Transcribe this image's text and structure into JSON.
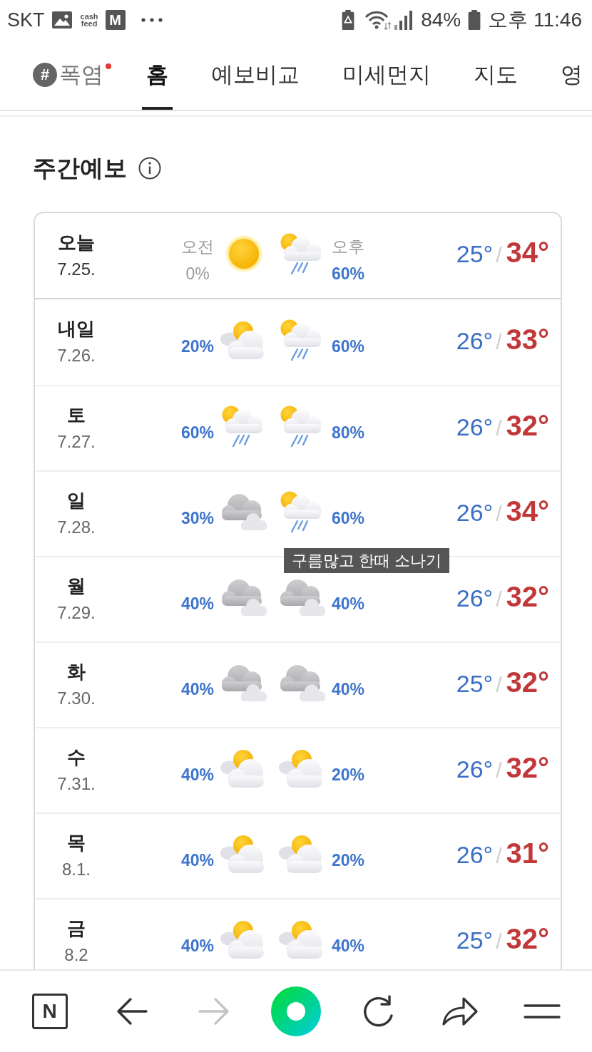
{
  "status_bar": {
    "carrier": "SKT",
    "left_icons": [
      {
        "kind": "image"
      },
      {
        "kind": "text_logo",
        "lines": [
          "cash",
          "feed"
        ]
      },
      {
        "kind": "letter_app",
        "letter": "M"
      },
      {
        "kind": "more"
      }
    ],
    "right_items": [
      {
        "kind": "battery_saver"
      },
      {
        "kind": "wifi"
      },
      {
        "kind": "signal"
      },
      {
        "kind": "battery_percent",
        "text": "84%"
      },
      {
        "kind": "battery"
      },
      {
        "kind": "clock",
        "text": "오후 11:46"
      }
    ]
  },
  "tabs": [
    {
      "hashtag": "#",
      "label": "폭염",
      "new": true,
      "selected": false
    },
    {
      "label": "홈",
      "new": false,
      "selected": true
    },
    {
      "label": "예보비교",
      "new": false,
      "selected": false
    },
    {
      "label": "미세먼지",
      "new": false,
      "selected": false
    },
    {
      "label": "지도",
      "new": false,
      "selected": false
    },
    {
      "label": "영",
      "new": false,
      "selected": false
    }
  ],
  "section": {
    "title": "주간예보"
  },
  "forecast": [
    {
      "day": "오늘",
      "date": "7.25.",
      "today": true,
      "periods": [
        {
          "kind": "sunny",
          "label": "오전",
          "chance": "0%",
          "muted": true
        },
        {
          "kind": "shower",
          "label": "오후",
          "chance": "60%",
          "muted": false
        }
      ],
      "low": "25°",
      "sep": "/",
      "high": "34°"
    },
    {
      "day": "내일",
      "date": "7.26.",
      "today": false,
      "periods": [
        {
          "kind": "partly_cloudy",
          "chance": "20%",
          "muted": false
        },
        {
          "kind": "shower",
          "chance": "60%",
          "muted": false
        }
      ],
      "low": "26°",
      "sep": "/",
      "high": "33°"
    },
    {
      "day": "토",
      "date": "7.27.",
      "today": false,
      "periods": [
        {
          "kind": "shower",
          "chance": "60%",
          "muted": false
        },
        {
          "kind": "shower",
          "chance": "80%",
          "muted": false
        }
      ],
      "low": "26°",
      "sep": "/",
      "high": "32°"
    },
    {
      "day": "일",
      "date": "7.28.",
      "today": false,
      "periods": [
        {
          "kind": "cloudy",
          "chance": "30%",
          "muted": false
        },
        {
          "kind": "shower",
          "chance": "60%",
          "muted": false,
          "tooltip": "구름많고 한때 소나기"
        }
      ],
      "low": "26°",
      "sep": "/",
      "high": "34°"
    },
    {
      "day": "월",
      "date": "7.29.",
      "today": false,
      "periods": [
        {
          "kind": "cloudy",
          "chance": "40%",
          "muted": false
        },
        {
          "kind": "cloudy",
          "chance": "40%",
          "muted": false
        }
      ],
      "low": "26°",
      "sep": "/",
      "high": "32°"
    },
    {
      "day": "화",
      "date": "7.30.",
      "today": false,
      "periods": [
        {
          "kind": "cloudy",
          "chance": "40%",
          "muted": false
        },
        {
          "kind": "cloudy",
          "chance": "40%",
          "muted": false
        }
      ],
      "low": "25°",
      "sep": "/",
      "high": "32°"
    },
    {
      "day": "수",
      "date": "7.31.",
      "today": false,
      "periods": [
        {
          "kind": "partly_cloudy",
          "chance": "40%",
          "muted": false
        },
        {
          "kind": "partly_cloudy",
          "chance": "20%",
          "muted": false
        }
      ],
      "low": "26°",
      "sep": "/",
      "high": "32°"
    },
    {
      "day": "목",
      "date": "8.1.",
      "today": false,
      "periods": [
        {
          "kind": "partly_cloudy",
          "chance": "40%",
          "muted": false
        },
        {
          "kind": "partly_cloudy",
          "chance": "20%",
          "muted": false
        }
      ],
      "low": "26°",
      "sep": "/",
      "high": "31°"
    },
    {
      "day": "금",
      "date": "8.2",
      "today": false,
      "periods": [
        {
          "kind": "partly_cloudy",
          "chance": "40%",
          "muted": false
        },
        {
          "kind": "partly_cloudy",
          "chance": "40%",
          "muted": false
        }
      ],
      "low": "25°",
      "sep": "/",
      "high": "32°"
    }
  ],
  "bottom_nav": [
    {
      "kind": "home",
      "label": "N",
      "disabled": false
    },
    {
      "kind": "back",
      "disabled": false
    },
    {
      "kind": "forward",
      "disabled": true
    },
    {
      "kind": "ring",
      "disabled": false
    },
    {
      "kind": "refresh",
      "disabled": false
    },
    {
      "kind": "share",
      "disabled": false
    },
    {
      "kind": "menu",
      "disabled": false
    }
  ]
}
